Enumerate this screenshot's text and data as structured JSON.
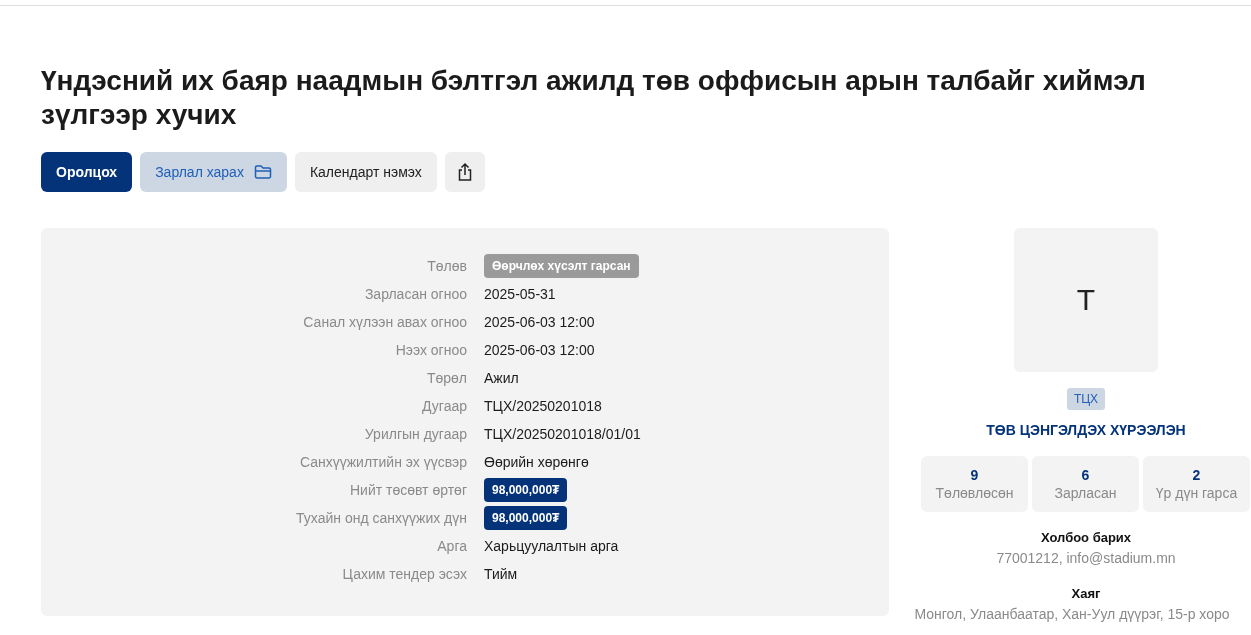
{
  "title": "Үндэсний их баяр наадмын бэлтгэл ажилд төв оффисын арын талбайг хиймэл зүлгээр хучих",
  "actions": [
    {
      "label": "Оролцох",
      "kind": "primary"
    },
    {
      "label": "Зарлал харах",
      "kind": "secondary"
    },
    {
      "label": "Календарт нэмэх",
      "kind": "plain"
    },
    {
      "kind": "share"
    }
  ],
  "details": [
    {
      "label": "Төлөв",
      "value": "Өөрчлөх хүсэлт гарсан",
      "kind": "status"
    },
    {
      "label": "Зарласан огноо",
      "value": "2025-05-31",
      "kind": "text"
    },
    {
      "label": "Санал хүлээн авах огноо",
      "value": "2025-06-03 12:00",
      "kind": "text"
    },
    {
      "label": "Нээх огноо",
      "value": "2025-06-03 12:00",
      "kind": "text"
    },
    {
      "label": "Төрөл",
      "value": "Ажил",
      "kind": "text"
    },
    {
      "label": "Дугаар",
      "value": "ТЦХ/20250201018",
      "kind": "text"
    },
    {
      "label": "Урилгын дугаар",
      "value": "ТЦХ/20250201018/01/01",
      "kind": "text"
    },
    {
      "label": "Санхүүжилтийн эх үүсвэр",
      "value": "Өөрийн хөрөнгө",
      "kind": "text"
    },
    {
      "label": "Нийт төсөвт өртөг",
      "value": "98,000,000₮",
      "kind": "amount"
    },
    {
      "label": "Тухайн онд санхүүжих дүн",
      "value": "98,000,000₮",
      "kind": "amount"
    },
    {
      "label": "Арга",
      "value": "Харьцуулалтын арга",
      "kind": "text"
    },
    {
      "label": "Цахим тендер эсэх",
      "value": "Тийм",
      "kind": "text"
    }
  ],
  "organization": {
    "logo_letter": "T",
    "tag": "ТЦХ",
    "name": "ТӨВ ЦЭНГЭЛДЭХ ХҮРЭЭЛЭН",
    "stats": [
      {
        "value": "9",
        "label": "Төлөвлөсөн"
      },
      {
        "value": "6",
        "label": "Зарласан"
      },
      {
        "value": "2",
        "label": "Үр дүн гарса"
      }
    ],
    "contact_heading": "Холбоо барих",
    "contact": "77001212, info@stadium.mn",
    "address_heading": "Хаяг",
    "address_lines": [
      "Монгол, Улаанбаатар, Хан-Уул дүүрэг, 15-р хоро"
    ]
  }
}
